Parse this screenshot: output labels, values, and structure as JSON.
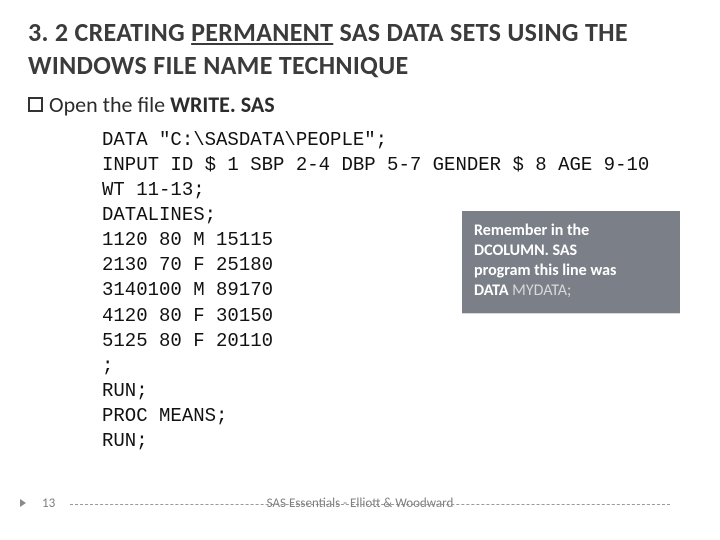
{
  "title": {
    "prefix": "3. 2 CREATING ",
    "underlined": "PERMANENT",
    "middle": " SAS DATA SETS USING THE WINDOWS FILE NAME TECHNIQUE"
  },
  "bullet": {
    "lead": "Open the file ",
    "filename": "WRITE. SAS"
  },
  "code": "DATA \"C:\\SASDATA\\PEOPLE\";\nINPUT ID $ 1 SBP 2-4 DBP 5-7 GENDER $ 8 AGE 9-10 WT 11-13;\nDATALINES;\n1120 80 M 15115\n2130 70 F 25180\n3140100 M 89170\n4120 80 F 30150\n5125 80 F 20110\n;\nRUN;\nPROC MEANS;\nRUN;",
  "callout": {
    "line1": "Remember in the",
    "line2a": "DCOLUMN. SAS",
    "line3": "program this line was",
    "line4a": "DATA ",
    "line4b": "MYDATA;"
  },
  "footer": {
    "page": "13",
    "credits": "SAS Essentials - Elliott & Woodward"
  }
}
